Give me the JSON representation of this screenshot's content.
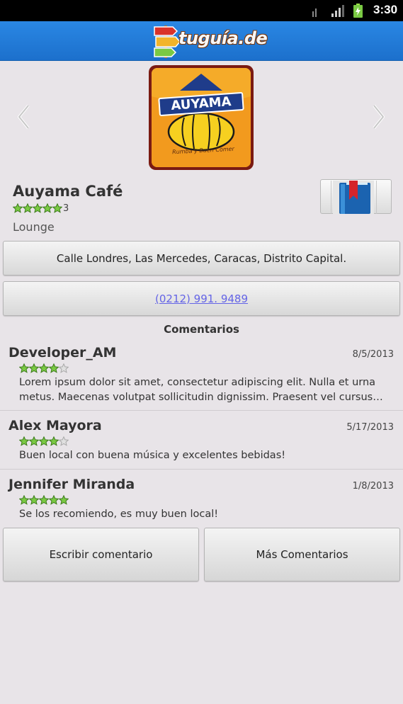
{
  "status_bar": {
    "network": "3G",
    "time": "3:30"
  },
  "header": {
    "logo_text": "tuguía.de"
  },
  "venue": {
    "logo_brand": "AUYAMA",
    "logo_tagline": "Rumba y Buen Comer",
    "name": "Auyama Café",
    "rating": 5,
    "rating_count": "3",
    "category": "Lounge",
    "address": "Calle Londres, Las Mercedes, Caracas, Distrito Capital.",
    "phone": "(0212) 991. 9489"
  },
  "comments_section": {
    "title": "Comentarios",
    "items": [
      {
        "author": "Developer_AM",
        "date": "8/5/2013",
        "rating": 4,
        "text_line1": "Lorem ipsum dolor sit amet, consectetur adipiscing elit. Nulla et urna",
        "text_line2": "metus. Maecenas volutpat sollicitudin dignissim. Praesent vel cursus…"
      },
      {
        "author": "Alex Mayora",
        "date": "5/17/2013",
        "rating": 4,
        "text_line1": "Buen local con buena música y excelentes bebidas!"
      },
      {
        "author": "Jennifer Miranda",
        "date": "1/8/2013",
        "rating": 5,
        "text_line1": "Se los recomiendo, es muy buen local!"
      }
    ]
  },
  "actions": {
    "write_comment": "Escribir comentario",
    "more_comments": "Más Comentarios"
  },
  "colors": {
    "header_blue": "#1c70cc",
    "background": "#e8e4e8",
    "star_green": "#7ac943",
    "link": "#6464e6"
  }
}
